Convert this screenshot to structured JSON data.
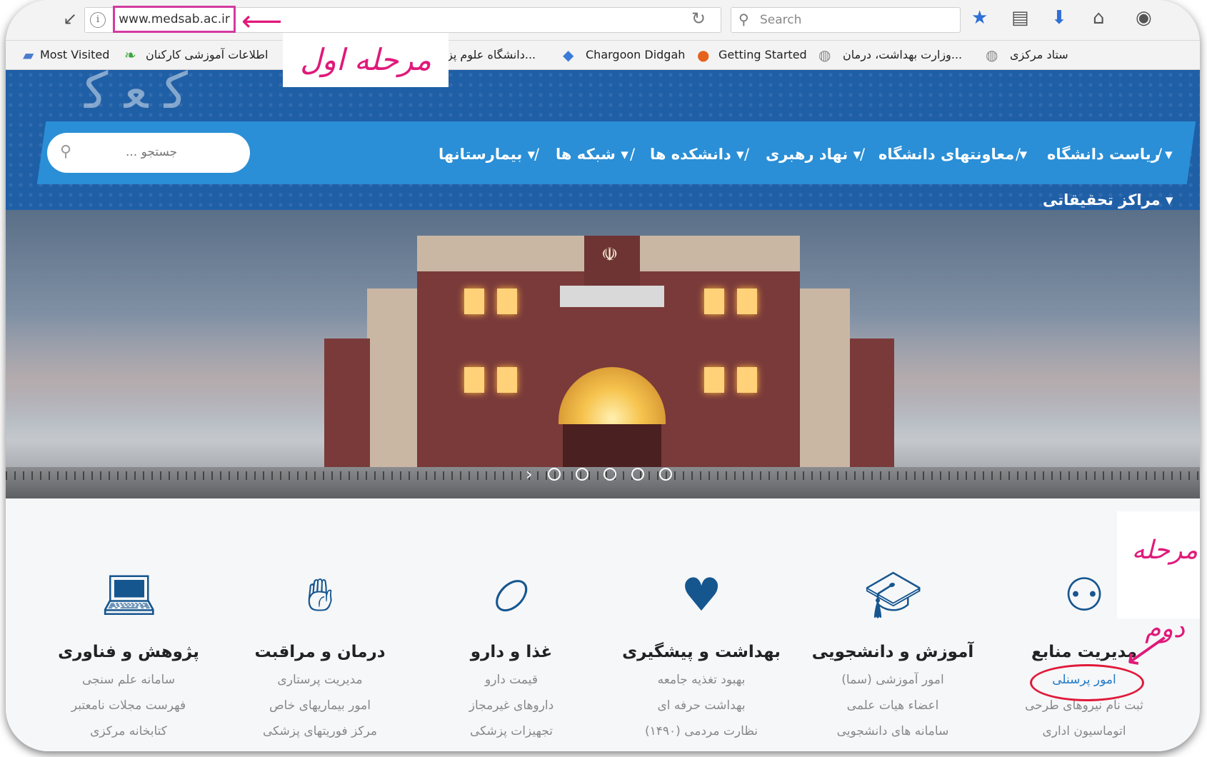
{
  "browser": {
    "url": "www.medsab.ac.ir",
    "search_placeholder": "Search",
    "icons": [
      "info-icon",
      "reload-icon",
      "search-icon",
      "bookmark-star-icon",
      "reading-list-icon",
      "download-icon",
      "home-icon",
      "pocket-icon"
    ]
  },
  "bookmarks": {
    "items": [
      {
        "label": "Most Visited"
      },
      {
        "label": "اطلاعات آموزشی کارکنان"
      },
      {
        "label": "...دانشگاه علوم پز"
      },
      {
        "label": "Chargoon Didgah"
      },
      {
        "label": "Getting Started"
      },
      {
        "label": "...وزارت بهداشت، درمان"
      },
      {
        "label": "ستاد مرکزی"
      }
    ]
  },
  "annotations": {
    "step1": "مرحله اول",
    "step2": "مرحله دوم",
    "arrow_color": "#e0197a"
  },
  "header": {
    "search_placeholder": "جستجو ...",
    "nav": [
      {
        "label": "ریاست دانشگاه"
      },
      {
        "label": "معاونتهای دانشگاه"
      },
      {
        "label": "نهاد رهبری"
      },
      {
        "label": "دانشکده ها"
      },
      {
        "label": "شبکه ها"
      },
      {
        "label": "بیمارستانها"
      }
    ],
    "nav_row2": [
      {
        "label": "مراکز تحقیقاتی"
      }
    ],
    "colors": {
      "bg": "#1f5fa6",
      "bar": "#2a8fd6"
    }
  },
  "hero": {
    "slide_count": 5,
    "next_label": "›"
  },
  "services": [
    {
      "title": "مدیریت منابع",
      "icon": "people-network-icon",
      "links": [
        "امور پرسنلی",
        "ثبت نام نیروهای طرحی",
        "اتوماسیون اداری"
      ]
    },
    {
      "title": "آموزش و دانشجویی",
      "icon": "graduation-cap-icon",
      "links": [
        "امور آموزشی (سما)",
        "اعضاء هیات علمی",
        "سامانه های دانشجویی"
      ]
    },
    {
      "title": "بهداشت و پیشگیری",
      "icon": "heart-plus-icon",
      "links": [
        "بهبود تغذیه جامعه",
        "بهداشت حرفه ای",
        "نظارت مردمی (۱۴۹۰)"
      ]
    },
    {
      "title": "غذا و دارو",
      "icon": "pill-icon",
      "links": [
        "قیمت دارو",
        "داروهای غیرمجاز",
        "تجهیزات پزشکی"
      ]
    },
    {
      "title": "درمان و مراقبت",
      "icon": "hands-box-icon",
      "links": [
        "مدیریت پرستاری",
        "امور بیماریهای خاص",
        "مرکز فوریتهای پزشکی"
      ]
    },
    {
      "title": "پژوهش و فناوری",
      "icon": "laptop-data-icon",
      "links": [
        "سامانه علم سنجی",
        "فهرست مجلات نامعتبر",
        "کتابخانه مرکزی"
      ]
    }
  ]
}
